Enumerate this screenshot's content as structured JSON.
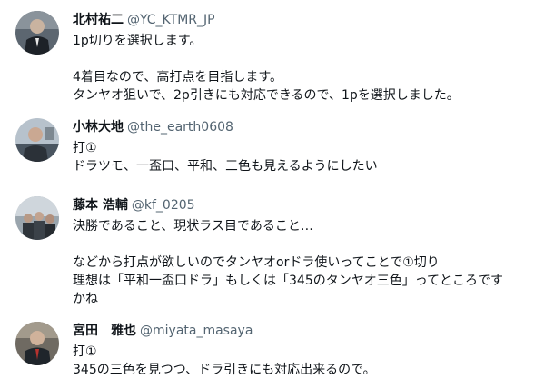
{
  "tweets": [
    {
      "name": "北村祐二",
      "handle": "@YC_KTMR_JP",
      "avatar": "avatar-photo",
      "lines": [
        "1p切りを選択します。",
        "",
        "4着目なので、高打点を目指します。",
        "タンヤオ狙いで、2p引きにも対応できるので、1pを選択しました。"
      ]
    },
    {
      "name": "小林大地",
      "handle": "@the_earth0608",
      "avatar": "avatar-photo",
      "lines": [
        "打①",
        "ドラツモ、一盃口、平和、三色も見えるようにしたい"
      ]
    },
    {
      "name": "藤本 浩輔",
      "handle": "@kf_0205",
      "avatar": "avatar-photo",
      "lines": [
        "決勝であること、現状ラス目であること…",
        "",
        "などから打点が欲しいのでタンヤオorドラ使いってことで①切り",
        "理想は「平和一盃口ドラ」もしくは「345のタンヤオ三色」ってところです",
        "かね"
      ]
    },
    {
      "name": "宮田　雅也",
      "handle": "@miyata_masaya",
      "avatar": "avatar-photo",
      "lines": [
        "打①",
        "345の三色を見つつ、ドラ引きにも対応出来るので。"
      ]
    }
  ]
}
